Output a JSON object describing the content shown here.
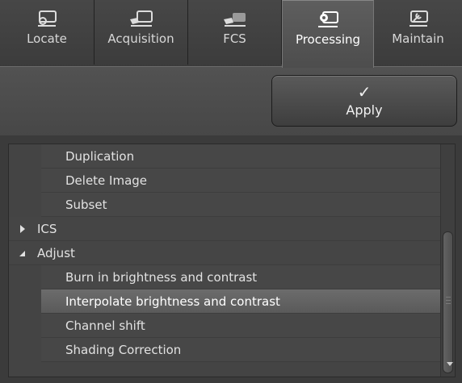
{
  "tabs": [
    {
      "label": "Locate",
      "icon": "locate-icon",
      "active": false
    },
    {
      "label": "Acquisition",
      "icon": "acquisition-icon",
      "active": false
    },
    {
      "label": "FCS",
      "icon": "fcs-icon",
      "active": false
    },
    {
      "label": "Processing",
      "icon": "processing-icon",
      "active": true
    },
    {
      "label": "Maintain",
      "icon": "maintain-icon",
      "active": false
    }
  ],
  "toolbar": {
    "apply_icon": "✓",
    "apply_label": "Apply"
  },
  "tree": {
    "items": [
      {
        "label": "Duplication",
        "level": 1,
        "selected": false
      },
      {
        "label": "Delete Image",
        "level": 1,
        "selected": false
      },
      {
        "label": "Subset",
        "level": 1,
        "selected": false
      },
      {
        "label": "ICS",
        "level": 0,
        "state": "collapsed"
      },
      {
        "label": "Adjust",
        "level": 0,
        "state": "expanded"
      },
      {
        "label": "Burn in brightness and contrast",
        "level": 1,
        "selected": false
      },
      {
        "label": "Interpolate brightness and contrast",
        "level": 1,
        "selected": true
      },
      {
        "label": "Channel shift",
        "level": 1,
        "selected": false
      },
      {
        "label": "Shading Correction",
        "level": 1,
        "selected": false
      }
    ]
  },
  "colors": {
    "background": "#3a3a3a",
    "selected_row": "#636363",
    "text": "#e2e2e2"
  }
}
